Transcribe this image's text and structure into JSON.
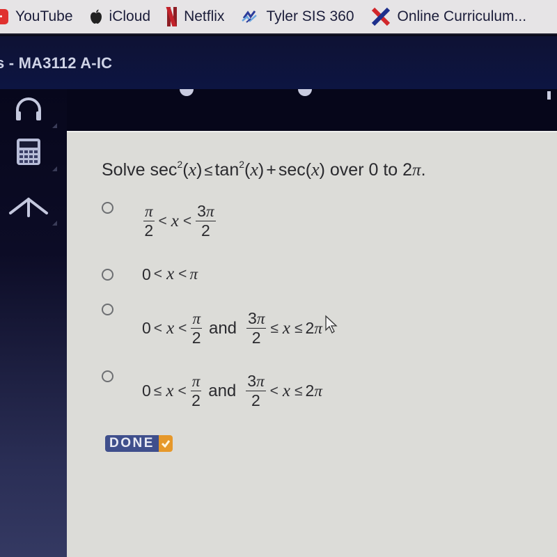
{
  "bookmarks": [
    {
      "label": "YouTube",
      "icon": "youtube-icon"
    },
    {
      "label": "iCloud",
      "icon": "apple-icon"
    },
    {
      "label": "Netflix",
      "icon": "netflix-icon"
    },
    {
      "label": "Tyler SIS 360",
      "icon": "tyler-sis-icon"
    },
    {
      "label": "Online Curriculum...",
      "icon": "online-curriculum-icon"
    }
  ],
  "course": {
    "title": "s - MA3112 A-IC"
  },
  "sidebar": {
    "tools": [
      {
        "name": "headphones-icon",
        "label": "Audio"
      },
      {
        "name": "calculator-icon",
        "label": "Calculator"
      },
      {
        "name": "highlighter-icon",
        "label": "Reference"
      }
    ]
  },
  "question": {
    "prefix": "Solve ",
    "lhs_fn": "sec",
    "lhs_exp": "2",
    "var": "x",
    "relation": "≤",
    "rhs_fn1": "tan",
    "rhs_exp1": "2",
    "plus": "+",
    "rhs_fn2": "sec",
    "suffix": " over 0 to 2",
    "pi": "π",
    "period": "."
  },
  "options": [
    {
      "id": "a",
      "text": "π/2 < x < 3π/2",
      "parts": {
        "f1_num": "π",
        "f1_den": "2",
        "op1": "<",
        "var": "x",
        "op2": "<",
        "f2_num_coef": "3",
        "f2_num_pi": "π",
        "f2_den": "2"
      },
      "selected": false
    },
    {
      "id": "b",
      "text": "0 < x < π",
      "parts": {
        "left": "0",
        "op1": "<",
        "var": "x",
        "op2": "<",
        "right": "π"
      },
      "selected": false
    },
    {
      "id": "c",
      "text": "0 < x < π/2 and 3π/2 ≤ x ≤ 2π",
      "parts": {
        "left": "0",
        "op1": "<",
        "var": "x",
        "op2": "<",
        "f1_num": "π",
        "f1_den": "2",
        "conj": "and",
        "f2_num_coef": "3",
        "f2_num_pi": "π",
        "f2_den": "2",
        "op3": "≤",
        "op4": "≤",
        "right_coef": "2",
        "right_pi": "π"
      },
      "selected": false
    },
    {
      "id": "d",
      "text": "0 ≤ x < π/2 and 3π/2 < x ≤ 2π",
      "parts": {
        "left": "0",
        "op1": "≤",
        "var": "x",
        "op2": "<",
        "f1_num": "π",
        "f1_den": "2",
        "conj": "and",
        "f2_num_coef": "3",
        "f2_num_pi": "π",
        "f2_den": "2",
        "op3": "<",
        "op4": "≤",
        "right_coef": "2",
        "right_pi": "π"
      },
      "selected": false
    }
  ],
  "done_button": {
    "label": "DONE",
    "icon": "checkmark-icon"
  },
  "colors": {
    "header_bg": "#0e1234",
    "content_bg": "#dcdcd8",
    "done_blue": "#3f4f8c",
    "done_orange": "#e6982a"
  }
}
